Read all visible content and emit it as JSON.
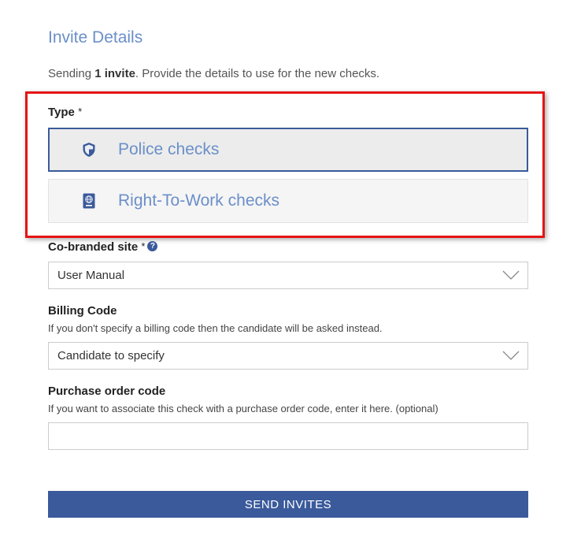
{
  "header": {
    "title": "Invite Details",
    "intro_prefix": "Sending ",
    "intro_count": "1 invite",
    "intro_suffix": ". Provide the details to use for the new checks."
  },
  "type_field": {
    "label": "Type",
    "required_mark": "*",
    "options": [
      {
        "label": "Police checks",
        "icon": "shield-icon",
        "selected": true
      },
      {
        "label": "Right-To-Work checks",
        "icon": "passport-icon",
        "selected": false
      }
    ]
  },
  "cobranded_field": {
    "label": "Co-branded site",
    "required_mark": "*",
    "help_icon": "?",
    "value": "User Manual"
  },
  "billing_field": {
    "label": "Billing Code",
    "hint": "If you don't specify a billing code then the candidate will be asked instead.",
    "value": "Candidate to specify"
  },
  "purchase_order_field": {
    "label": "Purchase order code",
    "hint": "If you want to associate this check with a purchase order code, enter it here. (optional)",
    "value": ""
  },
  "actions": {
    "send_label": "SEND INVITES"
  },
  "colors": {
    "accent": "#3a5a9b",
    "title_blue": "#6b8fc9",
    "highlight_red": "#e51414"
  }
}
